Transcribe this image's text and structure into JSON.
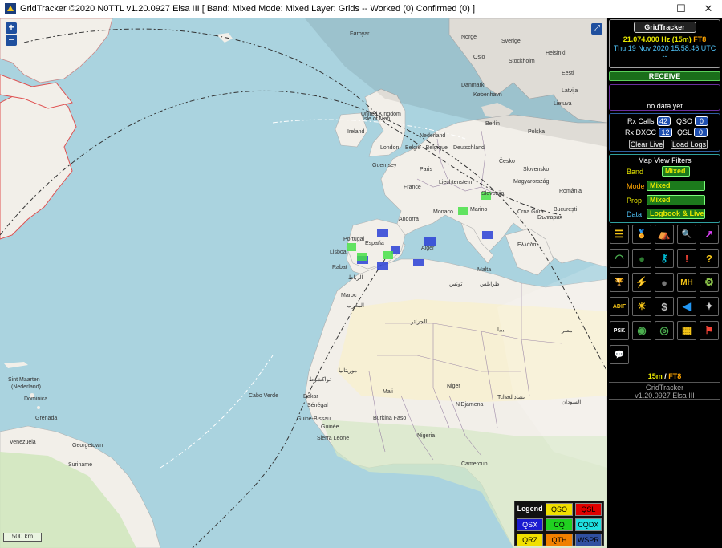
{
  "window": {
    "title": "GridTracker ©2020 N0TTL v1.20.0927 Elsa III [ Band: Mixed Mode: Mixed Layer: Grids -- Worked (0) Confirmed (0) ]",
    "minimize_glyph": "—",
    "maximize_glyph": "☐",
    "close_glyph": "✕"
  },
  "map": {
    "zoom_in": "+",
    "zoom_out": "−",
    "fullscreen_glyph": "⤢",
    "scale_label": "500 km",
    "labels": {
      "foroyar": "Føroyar",
      "ireland": "Ireland",
      "uk": "United Kingdom",
      "isle_of_man": "Isle of Man",
      "london": "London",
      "guernsey": "Guernsey",
      "nederland": "Nederland",
      "belgie": "België - Belgique",
      "deutschland": "Deutschland",
      "polska": "Polska",
      "paris": "Paris",
      "france": "France",
      "cesko": "Česko",
      "slovensko": "Slovensko",
      "magyarorszag": "Magyarország",
      "romania": "România",
      "liechtenstein": "Liechtenstein",
      "monaco": "Monaco",
      "sanmarino": "Marino",
      "crnagora": "Crna Gora",
      "bulgaria": "България",
      "bucuresti": "București",
      "andorra": "Andorra",
      "espana": "España",
      "portugal": "Portugal",
      "lisboa": "Lisboa",
      "rabat": "Rabat",
      "rabat_ar": "الرباط",
      "alger": "Alger",
      "ellada": "Ελλάδα",
      "malta": "Malta",
      "tunis": "تونس",
      "tarabulus": "طرابلس",
      "maroc": "Maroc",
      "maroc_ar": "المغرب",
      "algeria_ar": "الجزائر",
      "libya_ar": "ليبيا",
      "egypt_ar": "مصر",
      "mauritania_ar": "موريتانيا",
      "mali": "Mali",
      "niger": "Niger",
      "ndjamena": "N'Djamena",
      "tchad": "Tchad تشاد",
      "sudan": "السودان",
      "senegal": "Sénégal",
      "dakar": "Dakar",
      "guinebissau": "Guiné-Bissau",
      "guinee": "Guinée",
      "sierraleone": "Sierra Leone",
      "burkina": "Burkina Faso",
      "nigeria": "Nigeria",
      "cameroun": "Cameroun",
      "cabo_verde": "Cabo Verde",
      "nouakchott": "نواكشوط",
      "sintmaarten": "Sint Maarten",
      "nederland_car": "(Nederland)",
      "dominica": "Dominica",
      "grenada": "Grenada",
      "venezuela": "Venezuela",
      "georgetown": "Georgetown",
      "suriname": "Suriname",
      "helsinki": "Helsinki",
      "latvija": "Latvija",
      "lietuva": "Lietuva",
      "sverige": "Sverige",
      "stockholm": "Stockholm",
      "oslo": "Oslo",
      "norge": "Norge",
      "danmark": "Danmark",
      "kobenhavn": "København",
      "berlin": "Berlin",
      "eesti": "Eesti",
      "slovenija": "Slovenija"
    }
  },
  "legend": {
    "title": "Legend",
    "qso": "QSO",
    "qsl": "QSL",
    "qsx": "QSX",
    "cq": "CQ",
    "cqdx": "CQDX",
    "qrz": "QRZ",
    "qth": "QTH",
    "wspr": "WSPR"
  },
  "sidebar": {
    "app_name": "GridTracker",
    "frequency": "21.074.000 Hz (15m)",
    "mode": "FT8",
    "datetime": "Thu 19 Nov 2020 15:58:46 UTC",
    "dash": "--",
    "receive_label": "RECEIVE",
    "nodata": "..no data yet..",
    "stats": {
      "rx_calls_label": "Rx Calls",
      "rx_calls_value": "42",
      "qso_label": "QSO",
      "qso_value": "0",
      "rx_dxcc_label": "Rx DXCC",
      "rx_dxcc_value": "12",
      "qsl_label": "QSL",
      "qsl_value": "0",
      "clear_live": "Clear Live",
      "load_logs": "Load Logs"
    },
    "filters": {
      "heading": "Map View Filters",
      "band_label": "Band",
      "band_value": "Mixed",
      "mode_label": "Mode",
      "mode_value": "Mixed",
      "prop_label": "Prop",
      "prop_value": "Mixed",
      "data_label": "Data",
      "data_value": "Logbook & Live"
    },
    "tools": [
      {
        "icon": "log-list-icon",
        "glyph": "☰",
        "color": "#f5c518"
      },
      {
        "icon": "award-medal-icon",
        "glyph": "🏅",
        "color": "#f5c518"
      },
      {
        "icon": "pota-tent-icon",
        "glyph": "⛺",
        "color": "#ffffff"
      },
      {
        "icon": "search-icon",
        "glyph": "🔍",
        "color": "#ffffff"
      },
      {
        "icon": "chart-icon",
        "glyph": "↗",
        "color": "#e040fb"
      },
      {
        "icon": "wifi-icon",
        "glyph": "◠",
        "color": "#4caf50"
      },
      {
        "icon": "globe-icon",
        "glyph": "●",
        "color": "#2e7d32"
      },
      {
        "icon": "key-icon",
        "glyph": "⚷",
        "color": "#00bcd4"
      },
      {
        "icon": "alert-icon",
        "glyph": "!",
        "color": "#f44336"
      },
      {
        "icon": "help-icon",
        "glyph": "?",
        "color": "#f5c518"
      },
      {
        "icon": "trophy-icon",
        "glyph": "🏆",
        "color": "#f5c518"
      },
      {
        "icon": "lightning-icon",
        "glyph": "⚡",
        "color": "#ffffff"
      },
      {
        "icon": "moon-icon",
        "glyph": "●",
        "color": "#777777"
      },
      {
        "icon": "mh4-icon",
        "glyph": "MH",
        "color": "#f5c518"
      },
      {
        "icon": "settings-gear-icon",
        "glyph": "⚙",
        "color": "#8bc34a"
      },
      {
        "icon": "adif-icon",
        "glyph": "ADIF",
        "color": "#f5c518"
      },
      {
        "icon": "sun-icon",
        "glyph": "☀",
        "color": "#f5c518"
      },
      {
        "icon": "hand-money-icon",
        "glyph": "$",
        "color": "#bbbbbb"
      },
      {
        "icon": "speaker-icon",
        "glyph": "◀",
        "color": "#2196f3"
      },
      {
        "icon": "satellite-icon",
        "glyph": "✦",
        "color": "#cccccc"
      },
      {
        "icon": "psk24-icon",
        "glyph": "PSK",
        "color": "#ffffff"
      },
      {
        "icon": "globe-search-icon",
        "glyph": "◉",
        "color": "#4caf50"
      },
      {
        "icon": "radar-icon",
        "glyph": "◎",
        "color": "#4caf50"
      },
      {
        "icon": "grid-square-icon",
        "glyph": "▦",
        "color": "#f5c518"
      },
      {
        "icon": "golf-flag-icon",
        "glyph": "⚑",
        "color": "#f44336"
      },
      {
        "icon": "chat-icon",
        "glyph": "💬",
        "color": "#00bcd4"
      }
    ],
    "band_line_band": "15m",
    "band_line_sep": "/",
    "band_line_mode": "FT8",
    "version_name": "GridTracker",
    "version": "v1.20.0927 Elsa III"
  }
}
